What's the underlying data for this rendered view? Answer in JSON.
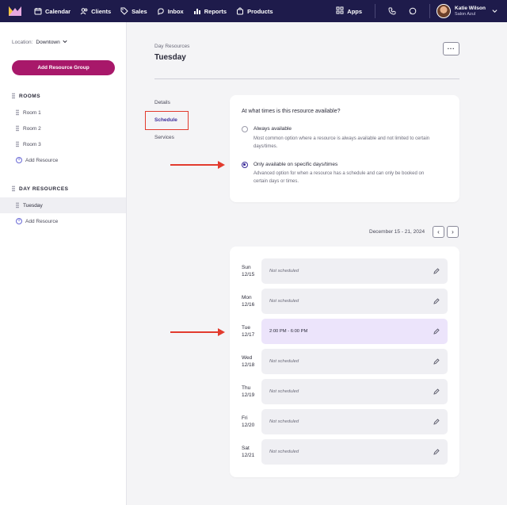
{
  "nav": {
    "items": [
      {
        "label": "Calendar",
        "icon": "calendar-icon"
      },
      {
        "label": "Clients",
        "icon": "clients-icon"
      },
      {
        "label": "Sales",
        "icon": "sales-tag-icon"
      },
      {
        "label": "Inbox",
        "icon": "inbox-icon"
      },
      {
        "label": "Reports",
        "icon": "reports-icon"
      },
      {
        "label": "Products",
        "icon": "products-bag-icon"
      }
    ],
    "apps_label": "Apps",
    "user_name": "Katie Wilson",
    "user_org": "Salon Azul"
  },
  "sidebar": {
    "location_label": "Location:",
    "location_value": "Downtown",
    "add_group_label": "Add Resource Group",
    "rooms_heading": "ROOMS",
    "rooms": [
      "Room 1",
      "Room 2",
      "Room 3"
    ],
    "add_resource_label": "Add Resource",
    "day_heading": "DAY RESOURCES",
    "day_items": [
      "Tuesday"
    ]
  },
  "main": {
    "breadcrumb": "Day Resources",
    "title": "Tuesday",
    "more_label": "···",
    "tabs": [
      "Details",
      "Schedule",
      "Services"
    ]
  },
  "availability": {
    "question": "At what times is this resource available?",
    "options": [
      {
        "title": "Always available",
        "desc": "Most common option where a resource is always available and not limited to certain days/times.",
        "selected": false
      },
      {
        "title": "Only available on specific days/times",
        "desc": "Advanced option for when a resource has a schedule and can only be booked on certain days or times.",
        "selected": true
      }
    ]
  },
  "schedule": {
    "week_label": "December 15 - 21, 2024",
    "prev_label": "‹",
    "next_label": "›",
    "days": [
      {
        "day": "Sun",
        "date": "12/15",
        "slot": "Not scheduled",
        "scheduled": false
      },
      {
        "day": "Mon",
        "date": "12/16",
        "slot": "Not scheduled",
        "scheduled": false
      },
      {
        "day": "Tue",
        "date": "12/17",
        "slot": "2:00 PM - 6:00 PM",
        "scheduled": true
      },
      {
        "day": "Wed",
        "date": "12/18",
        "slot": "Not scheduled",
        "scheduled": false
      },
      {
        "day": "Thu",
        "date": "12/19",
        "slot": "Not scheduled",
        "scheduled": false
      },
      {
        "day": "Fri",
        "date": "12/20",
        "slot": "Not scheduled",
        "scheduled": false
      },
      {
        "day": "Sat",
        "date": "12/21",
        "slot": "Not scheduled",
        "scheduled": false
      }
    ]
  },
  "colors": {
    "nav_bg": "#1e1b4b",
    "brand_button": "#a8186a",
    "accent": "#3d2f9b",
    "annotation_red": "#e23b2e",
    "scheduled_bg": "#ece4fb"
  }
}
